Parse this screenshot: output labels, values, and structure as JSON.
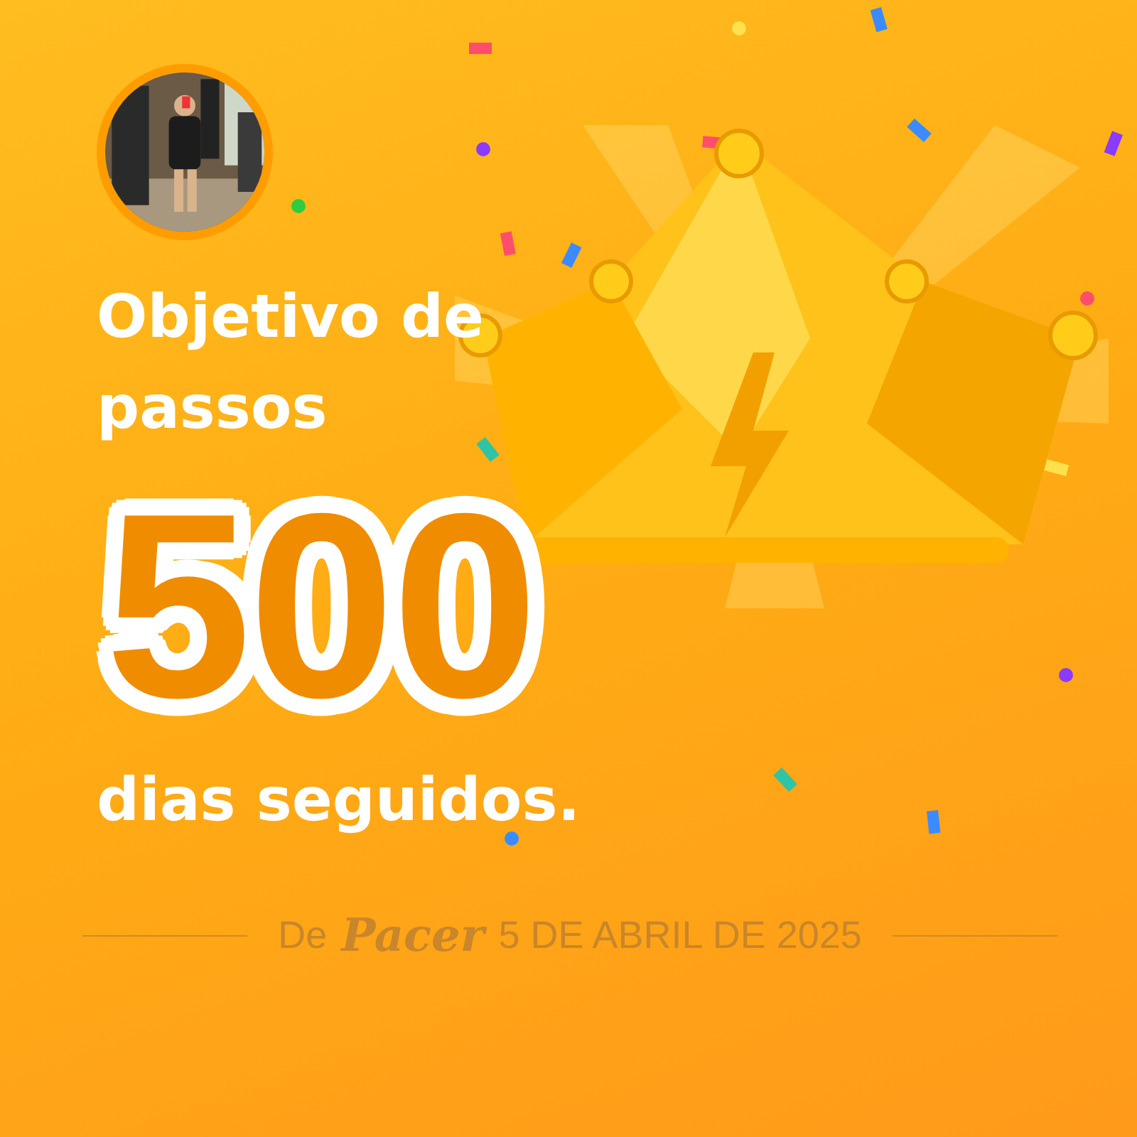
{
  "title": "Objetivo de passos",
  "count": "500",
  "subtitle": "dias seguidos.",
  "footer": {
    "prefix": "De",
    "brand": "Pacer",
    "date": "5 DE ABRIL DE 2025"
  }
}
